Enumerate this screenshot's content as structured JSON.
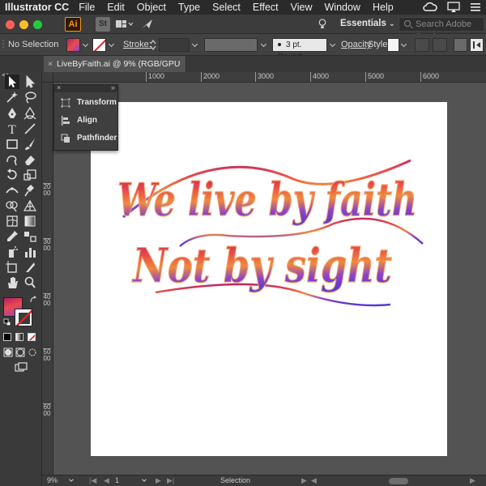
{
  "menubar": {
    "app_name": "Illustrator CC",
    "items": [
      "File",
      "Edit",
      "Object",
      "Type",
      "Select",
      "Effect",
      "View",
      "Window",
      "Help"
    ]
  },
  "appbar": {
    "ai_logo": "Ai",
    "stock_logo": "St",
    "workspace": "Essentials",
    "search_placeholder": "Search Adobe Stock"
  },
  "controlbar": {
    "selection_state": "No Selection",
    "stroke_label": "Stroke:",
    "brush_profile": "3 pt. Round",
    "opacity_label": "Opacity",
    "style_label": "Style:"
  },
  "document_tab": {
    "title": "LiveByFaith.ai @ 9% (RGB/GPU Preview)",
    "close": "×"
  },
  "rulers": {
    "horizontal": [
      "1000",
      "2000",
      "3000",
      "4000",
      "5000",
      "6000"
    ],
    "vertical": [
      "2000",
      "3000",
      "4000",
      "5000",
      "6000"
    ]
  },
  "floating_panel": {
    "close": "×",
    "collapse": "»",
    "items": [
      "Transform",
      "Align",
      "Pathfinder"
    ]
  },
  "artwork": {
    "line1": "We live by faith",
    "line2": "Not by sight",
    "gradient": [
      "#b21f6a",
      "#e94b4b",
      "#f08a3c",
      "#8e44c8",
      "#5b3bd0"
    ]
  },
  "statusbar": {
    "zoom": "9%",
    "artboard_number": "1",
    "tool_name": "Selection"
  },
  "colors": {
    "ui_dark": "#535353",
    "accent_orange": "#f7931e"
  }
}
